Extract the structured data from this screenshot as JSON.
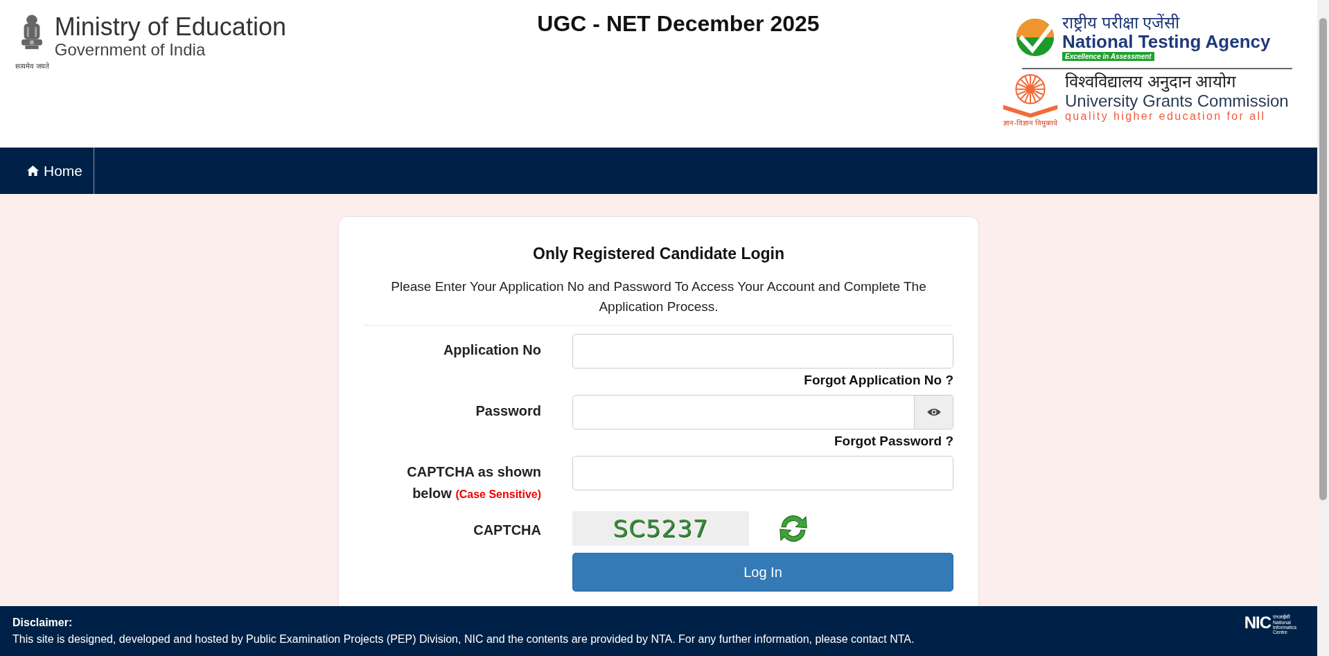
{
  "header": {
    "ministry": {
      "title": "Ministry of Education",
      "subtitle": "Government of India",
      "motto": "सत्यमेव जयते"
    },
    "exam_title": "UGC - NET December 2025",
    "nta": {
      "hindi": "राष्ट्रीय परीक्षा एजेंसी",
      "name": "National Testing Agency",
      "tagline": "Excellence in Assessment"
    },
    "ugc": {
      "hindi": "विश्वविद्यालय अनुदान आयोग",
      "name": "University Grants Commission",
      "tagline": "quality higher education for all",
      "motto": "ज्ञान-विज्ञान विमुक्तये"
    }
  },
  "nav": [
    {
      "label": "Home"
    }
  ],
  "login": {
    "title": "Only Registered Candidate Login",
    "description": "Please Enter Your Application No and Password To Access Your Account and Complete The Application Process.",
    "fields": [
      {
        "kind": "text",
        "label": "Application No",
        "link": "Forgot Application No ?"
      },
      {
        "kind": "password",
        "label": "Password",
        "link": "Forgot Password ?"
      },
      {
        "kind": "text",
        "label": "CAPTCHA as shown below",
        "note": "(Case Sensitive)"
      }
    ],
    "captcha": {
      "label": "CAPTCHA",
      "code": "SC5237"
    },
    "button": "Log In"
  },
  "footer": {
    "heading": "Disclaimer:",
    "text": "This site is designed, developed and hosted by Public Examination Projects (PEP) Division, NIC and the contents are provided by NTA. For any further information, please contact NTA.",
    "logo": {
      "name": "NIC",
      "hindi": "एनआईसी",
      "caption": "National Informatics Centre"
    }
  }
}
